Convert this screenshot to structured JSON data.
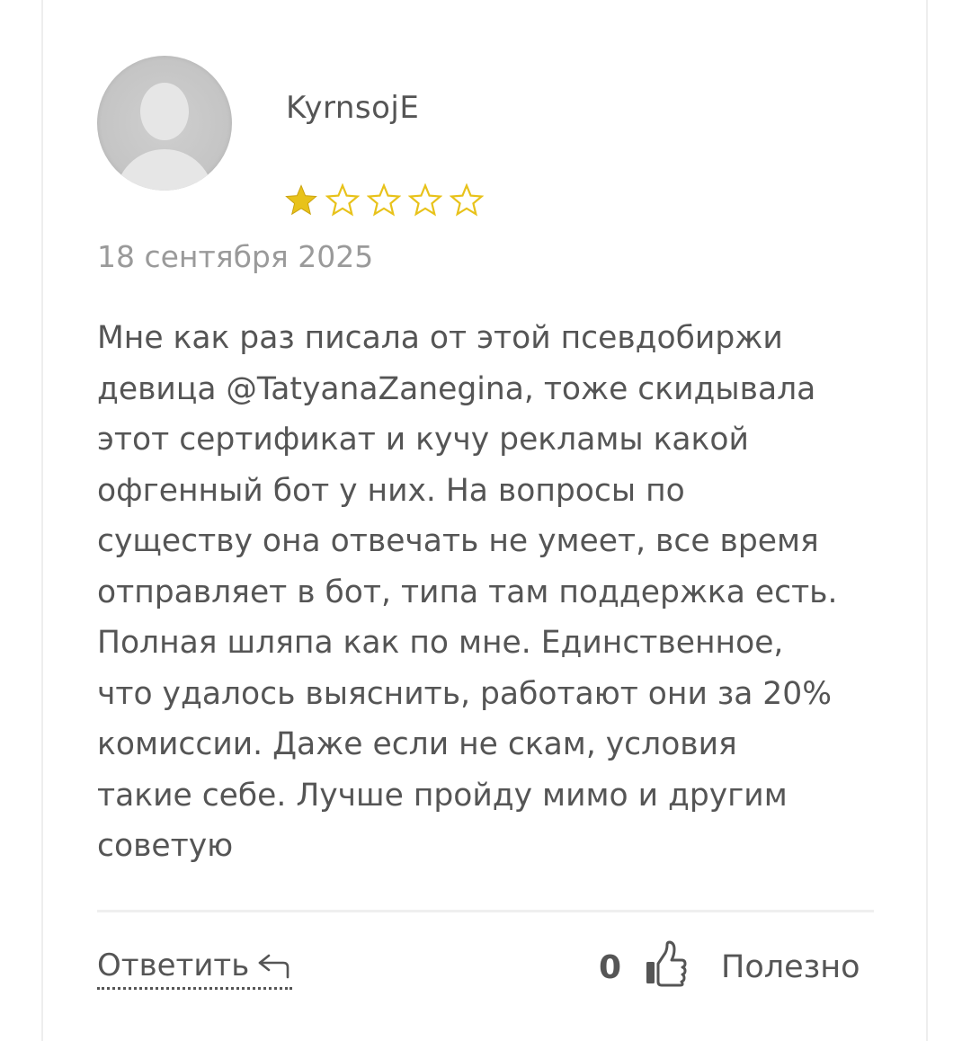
{
  "review": {
    "author": "KyrnsojE",
    "rating": 1,
    "rating_max": 5,
    "date": "18 сентября 2025",
    "text": "Мне как раз писала от этой псевдобиржи\nдевица @TatyanaZanegina, тоже скидывала\nэтот сертификат и кучу рекламы какой\nофгенный бот у них. На вопросы по\nсуществу она отвечать не умеет, все время\nотправляет в бот, типа там поддержка есть.\nПолная шляпа как по мне. Единственное,\nчто удалось выяснить, работают они за 20%\nкомиссии. Даже если не скам, условия\nтакие себе. Лучше пройду мимо и другим\nсоветую"
  },
  "actions": {
    "reply_label": "Ответить",
    "reply_icon": "reply-arrow-icon",
    "likes_count": "0",
    "like_icon": "thumbs-up-icon",
    "useful_label": "Полезно"
  },
  "colors": {
    "star_filled": "#e8c21a",
    "star_empty": "#e8c21a",
    "text": "#555555",
    "date": "#9a9a9a",
    "avatar_bg": "#c4c4c4"
  }
}
